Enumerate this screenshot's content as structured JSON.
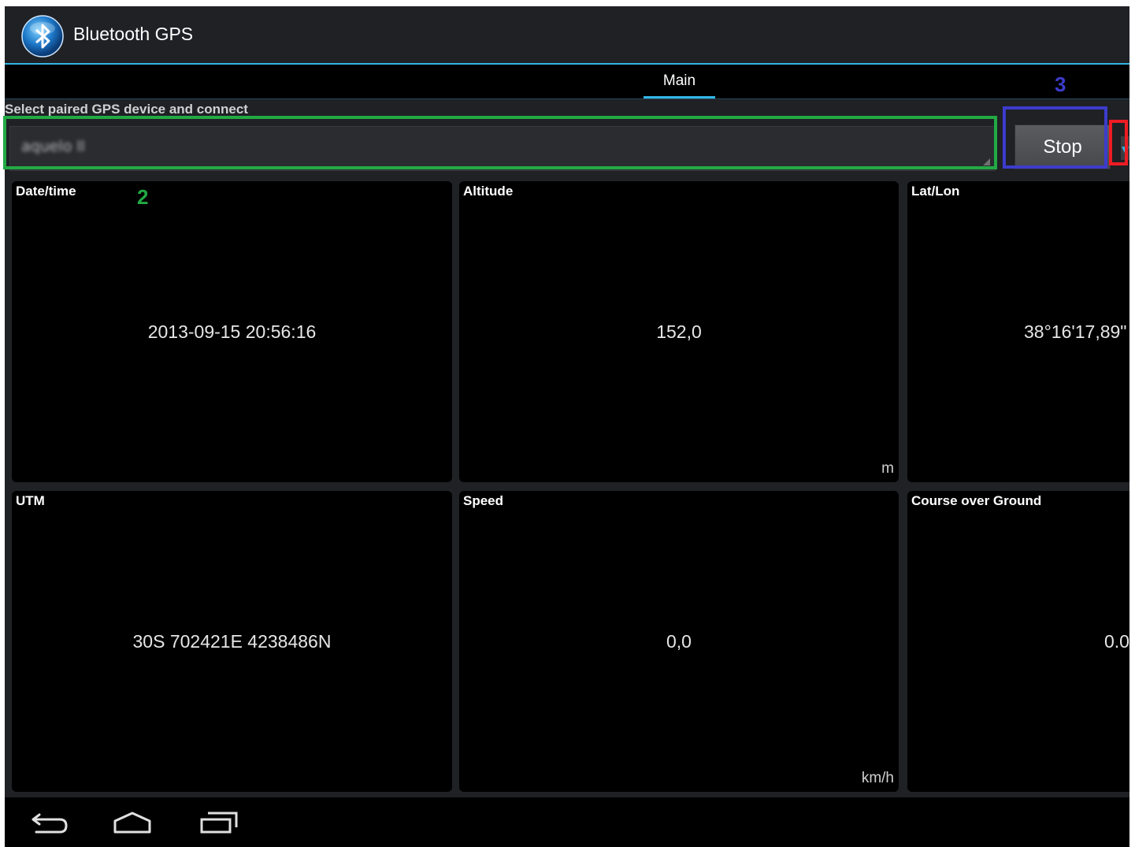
{
  "app": {
    "title": "Bluetooth GPS",
    "logo_icon": "bluetooth-icon"
  },
  "tabs": [
    {
      "label": "Main",
      "selected": true
    }
  ],
  "device_select": {
    "label": "Select paired GPS device and connect",
    "value": "aquelo ll",
    "button_label": "Stop"
  },
  "panels": {
    "datetime": {
      "title": "Date/time",
      "value": "2013-09-15 20:56:16",
      "unit": ""
    },
    "altitude": {
      "title": "Altitude",
      "value": "152,0",
      "unit": "m"
    },
    "latlon": {
      "title": "Lat/Lon",
      "value": "38°16'17,89\"",
      "unit": ""
    },
    "utm": {
      "title": "UTM",
      "value": "30S 702421E 4238486N",
      "unit": ""
    },
    "speed": {
      "title": "Speed",
      "value": "0,0",
      "unit": "km/h"
    },
    "course": {
      "title": "Course over Ground",
      "value": "0.0",
      "unit": ""
    }
  },
  "annotations": {
    "green_label": "2",
    "blue_label": "3"
  },
  "colors": {
    "accent": "#33b5e5",
    "panel_bg": "#000000",
    "screen_bg": "#1f2125"
  },
  "navbar": {
    "icons": [
      "back-icon",
      "home-icon",
      "recent-apps-icon"
    ]
  }
}
